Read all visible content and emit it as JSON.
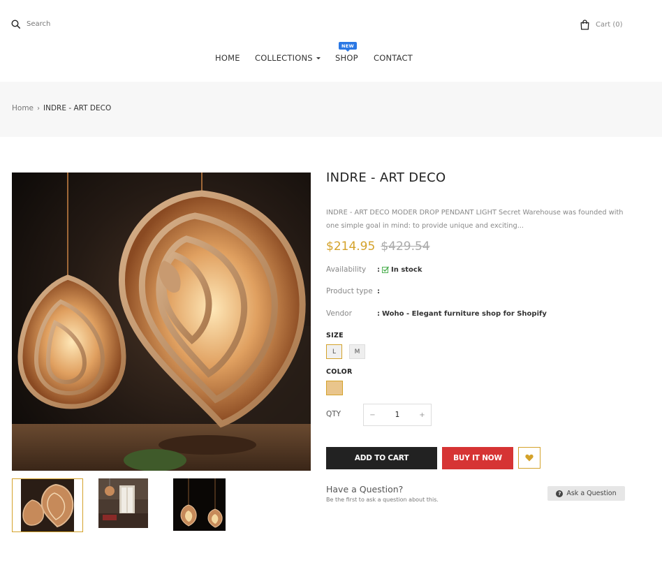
{
  "header": {
    "search_label": "Search",
    "cart_label": "Cart (0)"
  },
  "nav": {
    "home": "HOME",
    "collections": "COLLECTIONS",
    "shop": "SHOP",
    "shop_badge": "NEW",
    "contact": "CONTACT"
  },
  "breadcrumb": {
    "home": "Home",
    "separator": "›",
    "current": "INDRE - ART DECO"
  },
  "product": {
    "title": "INDRE - ART DECO",
    "description": "INDRE - ART DECO MODER DROP PENDANT LIGHT Secret Warehouse was founded with one simple goal in mind: to provide unique and exciting...",
    "price_now": "$214.95",
    "price_old": "$429.54",
    "availability_label": "Availability",
    "availability_value": "In stock",
    "product_type_label": "Product type",
    "product_type_value": "",
    "vendor_label": "Vendor",
    "vendor_value": "Woho - Elegant furniture shop for Shopify",
    "separator": ":",
    "size_label": "SIZE",
    "sizes": [
      "L",
      "M"
    ],
    "color_label": "COLOR",
    "color_swatch": "#e9c58c",
    "qty_label": "QTY",
    "qty_value": "1",
    "qty_minus": "−",
    "qty_plus": "+",
    "add_to_cart": "ADD TO CART",
    "buy_now": "BUY IT NOW"
  },
  "question": {
    "title": "Have a Question?",
    "subtitle": "Be the first to ask a question about this.",
    "ask_button": "Ask a Question"
  },
  "colors": {
    "accent": "#d4a22a",
    "buy_now_bg": "#d63434",
    "add_to_cart_bg": "#222222",
    "badge_bg": "#2b78e4",
    "in_stock_check": "#4caf50"
  }
}
